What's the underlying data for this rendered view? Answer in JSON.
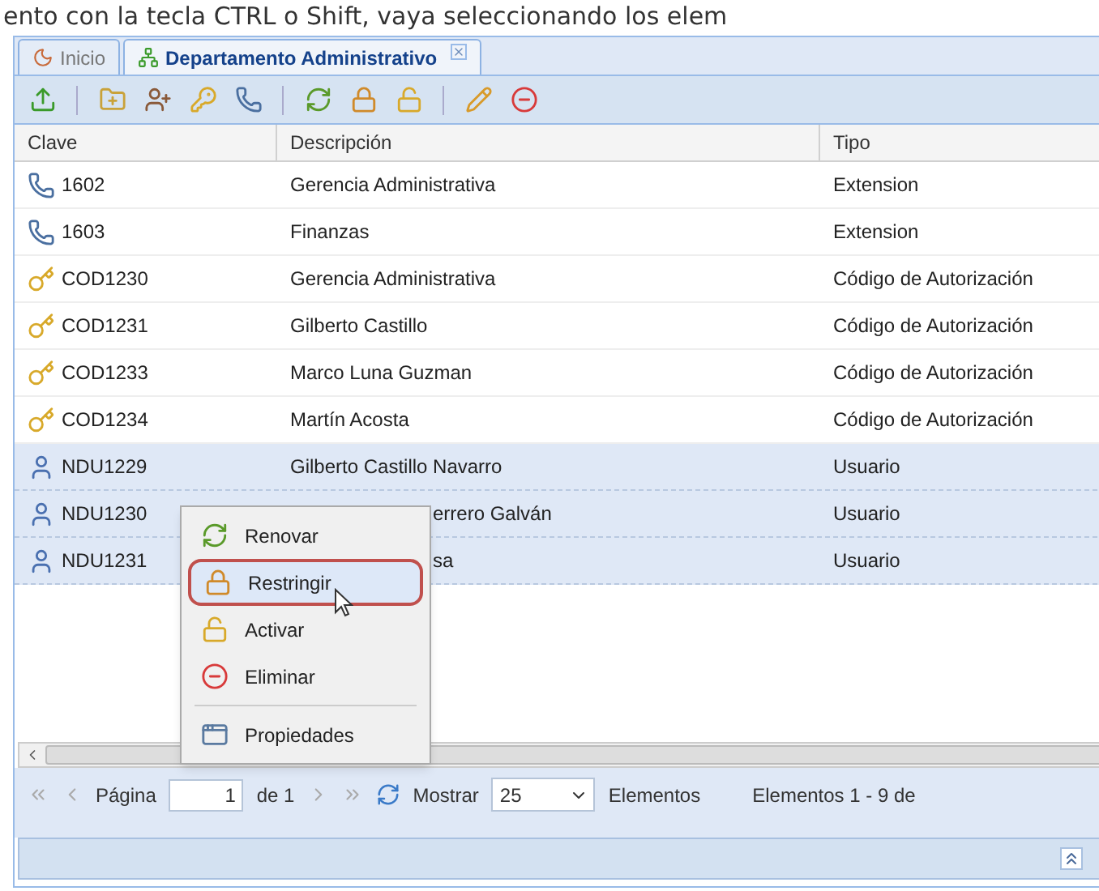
{
  "caption": "ento con la tecla CTRL o Shift, vaya seleccionando los elem",
  "tabs": [
    {
      "label": "Inicio",
      "selected": false,
      "closable": false
    },
    {
      "label": "Departamento Administrativo",
      "selected": true,
      "closable": true
    }
  ],
  "toolbar": [
    {
      "kind": "upload"
    },
    {
      "kind": "sep"
    },
    {
      "kind": "folder-add"
    },
    {
      "kind": "user-add"
    },
    {
      "kind": "key-add"
    },
    {
      "kind": "phone-add"
    },
    {
      "kind": "sep"
    },
    {
      "kind": "renew"
    },
    {
      "kind": "lock"
    },
    {
      "kind": "unlock"
    },
    {
      "kind": "sep"
    },
    {
      "kind": "edit"
    },
    {
      "kind": "delete"
    }
  ],
  "table": {
    "columns": [
      "Clave",
      "Descripción",
      "Tipo"
    ],
    "rows": [
      {
        "kind": "extension",
        "clave": "1602",
        "descripcion": "Gerencia Administrativa",
        "tipo": "Extension",
        "selected": false
      },
      {
        "kind": "extension",
        "clave": "1603",
        "descripcion": "Finanzas",
        "tipo": "Extension",
        "selected": false
      },
      {
        "kind": "code",
        "clave": "COD1230",
        "descripcion": "Gerencia Administrativa",
        "tipo": "Código de Autorización",
        "selected": false
      },
      {
        "kind": "code",
        "clave": "COD1231",
        "descripcion": "Gilberto Castillo",
        "tipo": "Código de Autorización",
        "selected": false
      },
      {
        "kind": "code",
        "clave": "COD1233",
        "descripcion": "Marco Luna Guzman",
        "tipo": "Código de Autorización",
        "selected": false
      },
      {
        "kind": "code",
        "clave": "COD1234",
        "descripcion": "Martín Acosta",
        "tipo": "Código de Autorización",
        "selected": false
      },
      {
        "kind": "user",
        "clave": "NDU1229",
        "descripcion": "Gilberto Castillo Navarro",
        "tipo": "Usuario",
        "selected": true,
        "covered": false
      },
      {
        "kind": "user",
        "clave": "NDU1230",
        "descripcion": "errero Galván",
        "tipo": "Usuario",
        "selected": true,
        "covered": true
      },
      {
        "kind": "user",
        "clave": "NDU1231",
        "descripcion": "sa",
        "tipo": "Usuario",
        "selected": true,
        "covered": true
      }
    ]
  },
  "context_menu": {
    "items": [
      {
        "kind": "renew",
        "label": "Renovar",
        "selected": false
      },
      {
        "kind": "lock",
        "label": "Restringir",
        "selected": true
      },
      {
        "kind": "unlock",
        "label": "Activar",
        "selected": false
      },
      {
        "kind": "delete",
        "label": "Eliminar",
        "selected": false
      },
      {
        "kind": "separator"
      },
      {
        "kind": "properties",
        "label": "Propiedades",
        "selected": false
      }
    ]
  },
  "paging": {
    "page_label": "Página",
    "page": "1",
    "of": "de 1",
    "show_label": "Mostrar",
    "page_size": "25",
    "items_label": "Elementos",
    "summary": "Elementos 1 - 9 de"
  }
}
